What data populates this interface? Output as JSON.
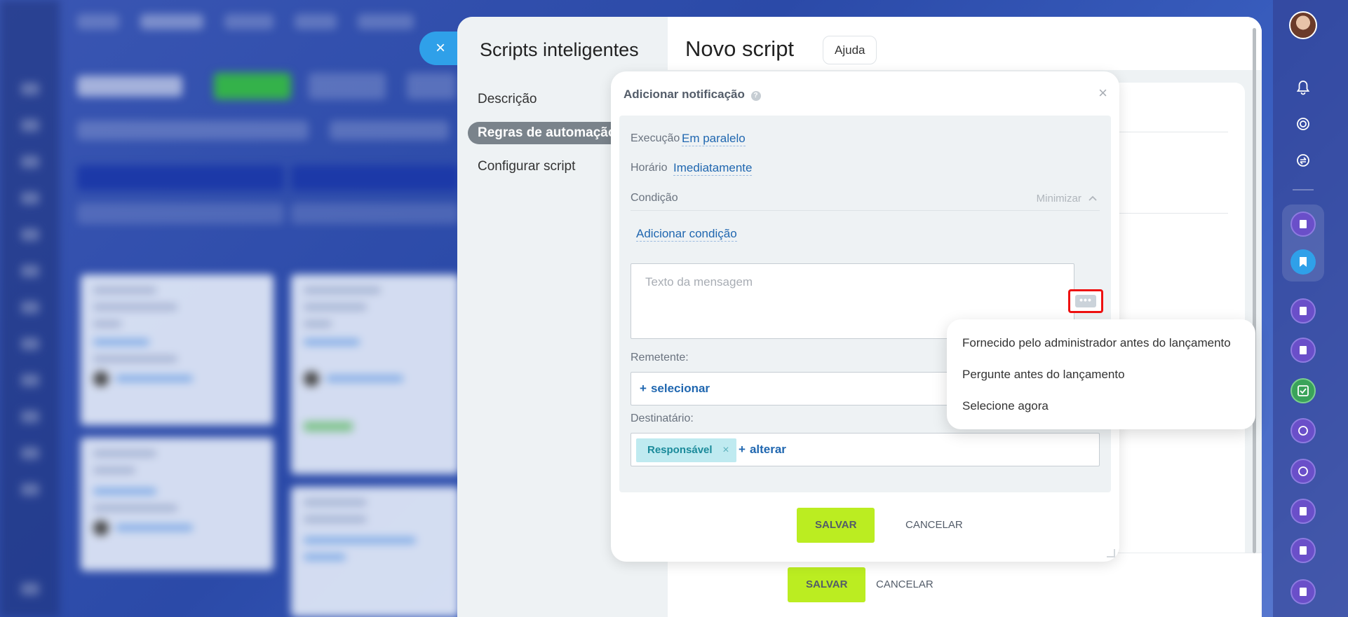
{
  "slider": {
    "title": "Scripts inteligentes",
    "nav": [
      {
        "label": "Descrição"
      },
      {
        "label": "Regras de automação",
        "active": true
      },
      {
        "label": "Configurar script"
      }
    ],
    "heading": "Novo script",
    "help_label": "Ajuda",
    "footer": {
      "save_label": "SALVAR",
      "cancel_label": "CANCELAR"
    }
  },
  "popup": {
    "title": "Adicionar notificação",
    "help_icon": "?",
    "close_icon": "×",
    "execution": {
      "label": "Execução",
      "value": "Em paralelo"
    },
    "schedule": {
      "label": "Horário",
      "value": "Imediatamente"
    },
    "condition": {
      "label": "Condição",
      "minimize_label": "Minimizar",
      "add_label": "Adicionar condição"
    },
    "message": {
      "placeholder": "Texto da mensagem",
      "value": ""
    },
    "more_button_glyph": "•••",
    "sender": {
      "label": "Remetente:",
      "add_label": "selecionar"
    },
    "recipient": {
      "label": "Destinatário:",
      "tag": "Responsável",
      "tag_remove": "×",
      "change_label": "alterar"
    },
    "save_label": "SALVAR",
    "cancel_label": "CANCELAR"
  },
  "dropdown": {
    "items": [
      "Fornecido pelo administrador antes do lançamento",
      "Pergunte antes do lançamento",
      "Selecione agora"
    ]
  },
  "colors": {
    "accent_blue": "#2fa0e9",
    "link": "#2067b0",
    "save_button": "#bbed21",
    "highlight_border": "#e11111",
    "tag_bg": "#bfeaf0"
  },
  "icons": {
    "close_slider": "×",
    "plus": "+"
  }
}
